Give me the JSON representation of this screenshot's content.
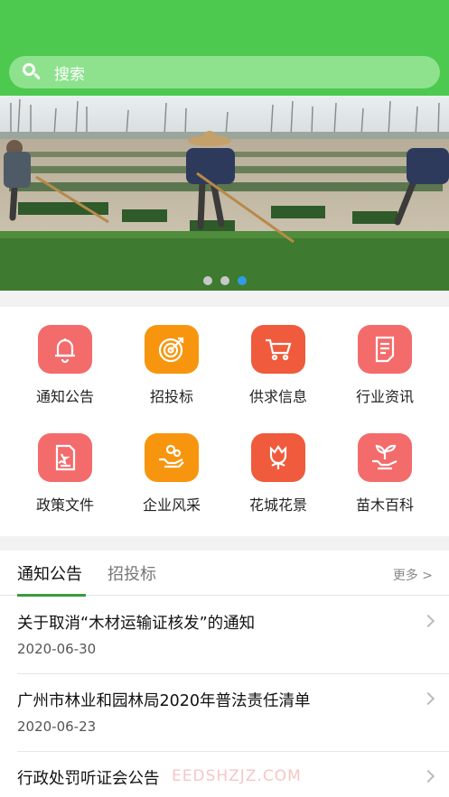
{
  "search": {
    "placeholder": "搜索"
  },
  "banner": {
    "dots": 3,
    "active_dot": 3
  },
  "categories": [
    {
      "label": "通知公告",
      "icon": "bell-icon",
      "color": "#f46b6b"
    },
    {
      "label": "招投标",
      "icon": "target-icon",
      "color": "#f7960e"
    },
    {
      "label": "供求信息",
      "icon": "cart-icon",
      "color": "#ef5b3c"
    },
    {
      "label": "行业资讯",
      "icon": "document-icon",
      "color": "#f46b6b"
    },
    {
      "label": "政策文件",
      "icon": "policy-file-icon",
      "color": "#f46b6b"
    },
    {
      "label": "企业风采",
      "icon": "hand-coin-icon",
      "color": "#f7960e"
    },
    {
      "label": "花城花景",
      "icon": "flower-icon",
      "color": "#ef5b3c"
    },
    {
      "label": "苗木百科",
      "icon": "seedling-hand-icon",
      "color": "#f46b6b"
    }
  ],
  "news": {
    "tabs": [
      "通知公告",
      "招投标"
    ],
    "more": "更多 >",
    "items": [
      {
        "title": "关于取消“木材运输证核发”的通知",
        "date": "2020-06-30"
      },
      {
        "title": "广州市林业和园林局2020年普法责任清单",
        "date": "2020-06-23"
      },
      {
        "title": "行政处罚听证会公告",
        "date": ""
      }
    ]
  },
  "watermark": "EEDSHZJZ.COM"
}
